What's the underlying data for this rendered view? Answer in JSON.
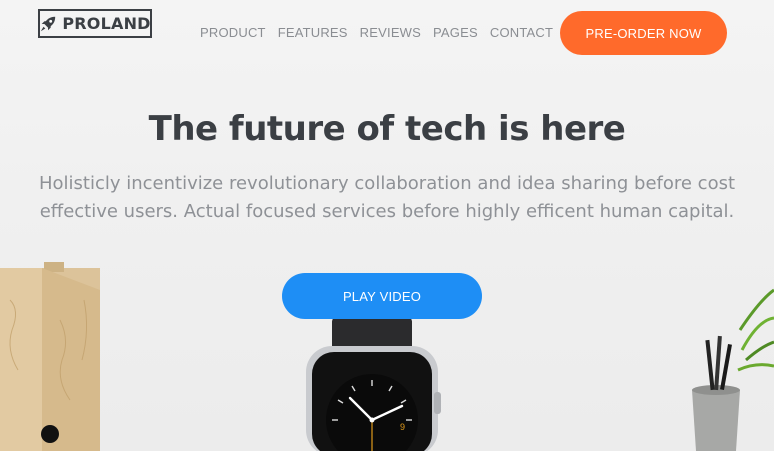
{
  "header": {
    "logo_text": "PROLAND",
    "logo_icon": "rocket-icon",
    "nav": [
      {
        "label": "PRODUCT"
      },
      {
        "label": "FEATURES"
      },
      {
        "label": "REVIEWS"
      },
      {
        "label": "PAGES"
      },
      {
        "label": "CONTACT"
      }
    ],
    "cta_label": "PRE-ORDER NOW"
  },
  "hero": {
    "headline": "The future of tech is here",
    "subtext": "Holisticly incentivize revolutionary collaboration and idea sharing before cost effective users. Actual focused services before highly efficent human capital.",
    "play_label": "PLAY VIDEO"
  },
  "colors": {
    "accent_orange": "#ff6a2b",
    "accent_blue": "#1e8ef5",
    "heading": "#3b3f44",
    "muted_text": "#8e9196"
  },
  "illustrations": [
    "smartwatch",
    "wooden-file-box",
    "plant-pot-with-pens"
  ]
}
